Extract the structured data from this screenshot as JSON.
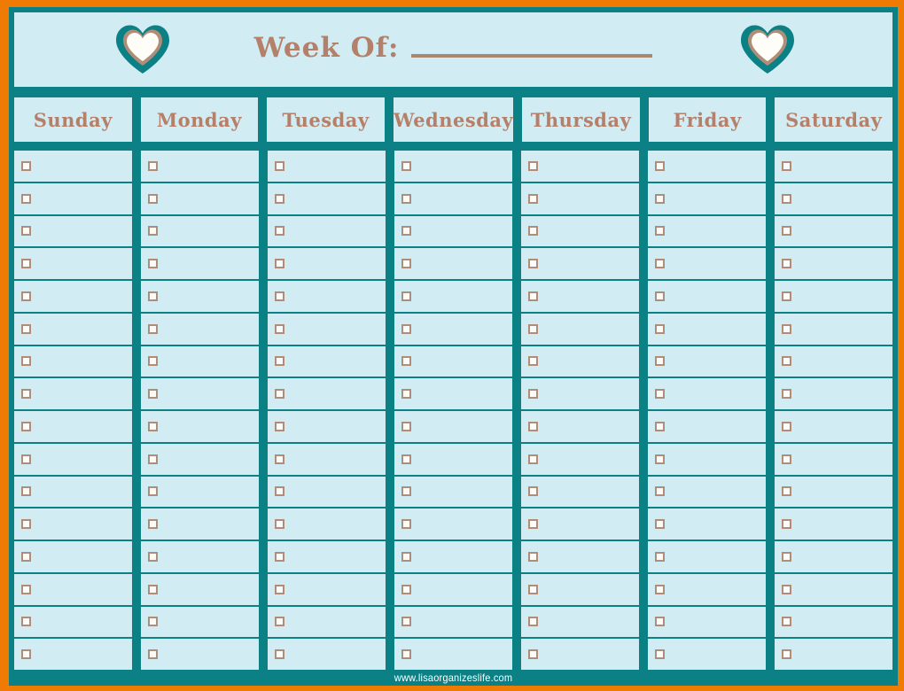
{
  "header": {
    "week_of_label": "Week Of:",
    "week_of_value": "",
    "left_icon": "heart-icon",
    "right_icon": "heart-icon"
  },
  "days": [
    {
      "label": "Sunday"
    },
    {
      "label": "Monday"
    },
    {
      "label": "Tuesday"
    },
    {
      "label": "Wednesday"
    },
    {
      "label": "Thursday"
    },
    {
      "label": "Friday"
    },
    {
      "label": "Saturday"
    }
  ],
  "grid": {
    "rows": 16,
    "columns": 7,
    "checkbox_icon": "checkbox-icon",
    "checkbox_checked": false
  },
  "footer": {
    "watermark": "www.lisaorganizeslife.com"
  },
  "colors": {
    "outer_border": "#ef7b04",
    "frame": "#0b8185",
    "cell_background": "#d2ecf4",
    "text": "#b5806a",
    "rule": "#a98871",
    "checkbox_border": "#b08d78",
    "checkbox_fill": "#fdfcfa",
    "heart_outer": "#0b8185",
    "heart_middle": "#b08d78",
    "heart_inner": "#fffdf8",
    "watermark_text": "#ffffff"
  }
}
